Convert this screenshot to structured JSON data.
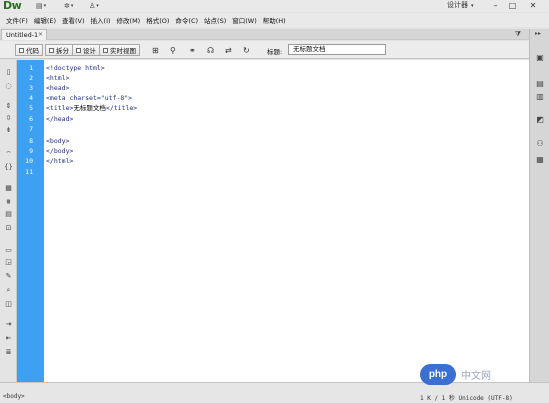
{
  "app": {
    "logo": "Dw",
    "workspace_label": "设计器",
    "window_buttons": [
      "–",
      "□",
      "✕"
    ]
  },
  "menubar": {
    "items": [
      "文件(F)",
      "编辑(E)",
      "查看(V)",
      "插入(I)",
      "修改(M)",
      "格式(O)",
      "命令(C)",
      "站点(S)",
      "窗口(W)",
      "帮助(H)"
    ]
  },
  "tabs": {
    "active": "Untitled-1",
    "close": "×"
  },
  "toolbar": {
    "views": [
      "代码",
      "拆分",
      "设计",
      "实时视图"
    ],
    "title_label": "标题:",
    "title_value": "无标题文档"
  },
  "editor": {
    "line_numbers": [
      "1",
      "2",
      "3",
      "4",
      "5",
      "6",
      "7",
      "8",
      "9",
      "10",
      "11"
    ],
    "lines": [
      {
        "tag": "<!doctype html>"
      },
      {
        "tag": "<html>"
      },
      {
        "tag": "<head>"
      },
      {
        "tag": "<meta charset=\"utf-8\">"
      },
      {
        "tag": "<title>",
        "text": "无标题文档",
        "tag2": "</title>"
      },
      {
        "tag": "</head>"
      },
      {
        "tag": ""
      },
      {
        "tag": "<body>"
      },
      {
        "tag": "</body>"
      },
      {
        "tag": "</html>"
      },
      {
        "tag": ""
      }
    ]
  },
  "statusbar": {
    "tag_selector": "<body>",
    "info": "1 K / 1 秒 Unicode (UTF-8)"
  },
  "watermark": {
    "badge": "php",
    "text": "中文网"
  },
  "colors": {
    "gutter": "#3ea0f0",
    "tag_text": "#1b2f8c",
    "logo": "#2f6f25",
    "watermark_badge": "#3b6fd1"
  }
}
